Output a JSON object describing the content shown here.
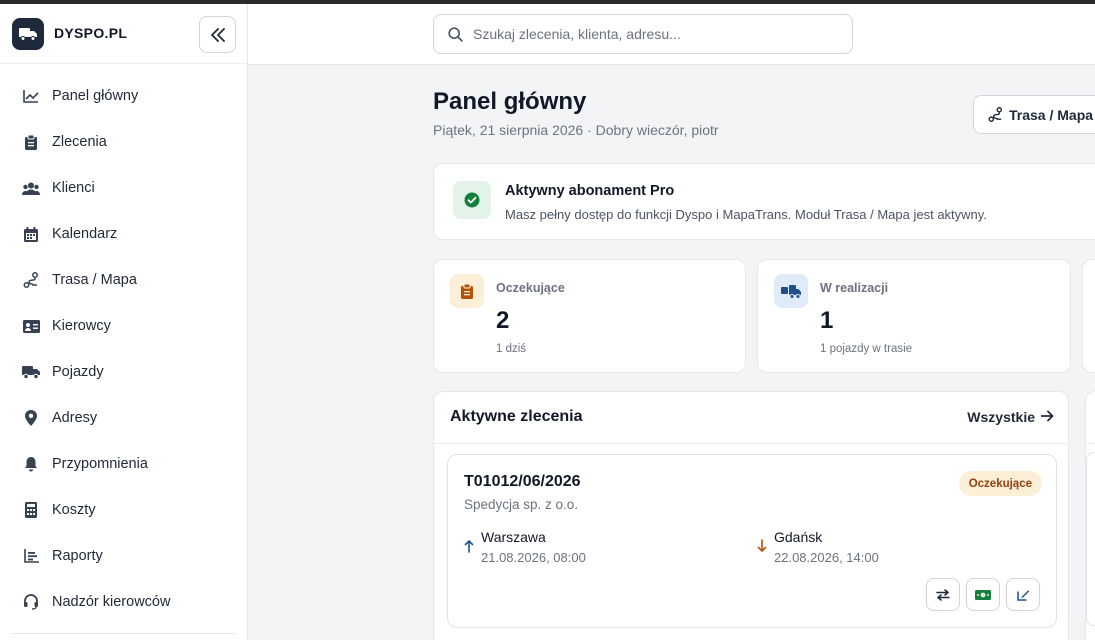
{
  "brand": {
    "name": "DYSPO.PL",
    "logo_icon": "truck-icon"
  },
  "sidebar": {
    "items": [
      {
        "label": "Panel główny",
        "icon": "chart-line-icon"
      },
      {
        "label": "Zlecenia",
        "icon": "clipboard-icon"
      },
      {
        "label": "Klienci",
        "icon": "users-icon"
      },
      {
        "label": "Kalendarz",
        "icon": "calendar-icon"
      },
      {
        "label": "Trasa / Mapa",
        "icon": "route-icon"
      },
      {
        "label": "Kierowcy",
        "icon": "id-card-icon"
      },
      {
        "label": "Pojazdy",
        "icon": "truck-icon"
      },
      {
        "label": "Adresy",
        "icon": "map-pin-icon"
      },
      {
        "label": "Przypomnienia",
        "icon": "bell-icon"
      },
      {
        "label": "Koszty",
        "icon": "calculator-icon"
      },
      {
        "label": "Raporty",
        "icon": "bar-chart-icon"
      },
      {
        "label": "Nadzór kierowców",
        "icon": "headset-icon"
      }
    ]
  },
  "search": {
    "placeholder": "Szukaj zlecenia, klienta, adresu..."
  },
  "page": {
    "title": "Panel główny",
    "subtitle": "Piątek, 21 sierpnia 2026 · Dobry wieczór, piotr",
    "route_button": "Trasa / Mapa"
  },
  "subscription": {
    "title": "Aktywny abonament Pro",
    "description": "Masz pełny dostęp do funkcji Dyspo i MapaTrans. Moduł Trasa / Mapa jest aktywny."
  },
  "stats": [
    {
      "label": "Oczekujące",
      "value": "2",
      "note": "1 dziś",
      "color": "#fbefd8"
    },
    {
      "label": "W realizacji",
      "value": "1",
      "note": "1 pojazdy w trasie",
      "color": "#e0ebf8"
    }
  ],
  "orders": {
    "title": "Aktywne zlecenia",
    "all_link": "Wszystkie",
    "items": [
      {
        "number": "T01012/06/2026",
        "client": "Spedycja sp. z o.o.",
        "status": "Oczekujące",
        "from_city": "Warszawa",
        "from_date": "21.08.2026, 08:00",
        "to_city": "Gdańsk",
        "to_date": "22.08.2026, 14:00"
      }
    ]
  },
  "colors": {
    "accent": "#1e2a3b",
    "success": "#15803d",
    "warning": "#b45309",
    "info": "#1e4f8a"
  }
}
